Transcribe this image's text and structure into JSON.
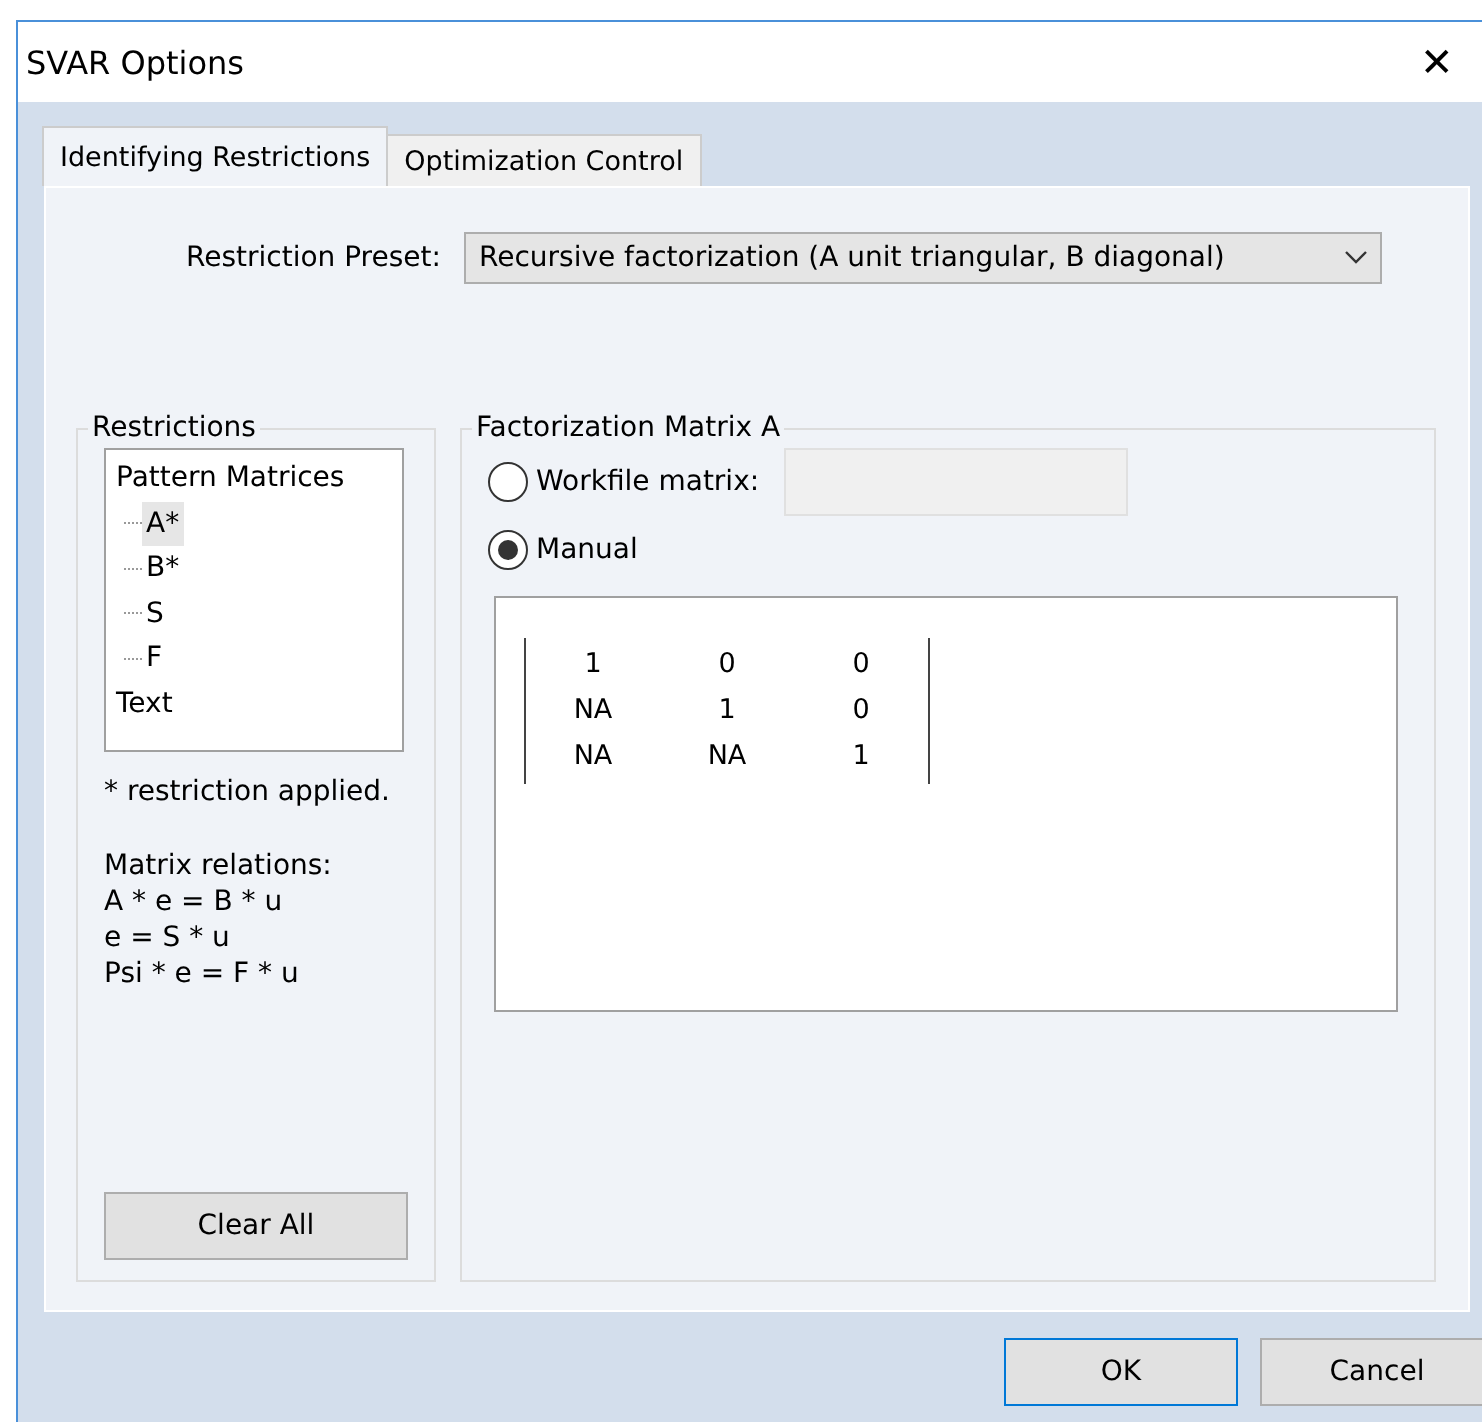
{
  "window": {
    "title": "SVAR Options",
    "close": "✕"
  },
  "tabs": [
    {
      "label": "Identifying Restrictions",
      "selected": true
    },
    {
      "label": "Optimization Control",
      "selected": false
    }
  ],
  "preset": {
    "label": "Restriction Preset:",
    "value": "Recursive factorization (A unit triangular, B diagonal)"
  },
  "restrictions": {
    "title": "Restrictions",
    "tree": [
      {
        "label": "Pattern Matrices",
        "selected": false,
        "children": [
          {
            "label": "A*",
            "selected": true
          },
          {
            "label": "B*",
            "selected": false
          },
          {
            "label": "S",
            "selected": false
          },
          {
            "label": "F",
            "selected": false
          }
        ]
      },
      {
        "label": "Text",
        "selected": false
      }
    ],
    "note": "* restriction applied.",
    "relations": [
      "Matrix relations:",
      "A * e = B * u",
      "e = S * u",
      "Psi * e = F * u"
    ],
    "button": "Clear All"
  },
  "factorization": {
    "title": "Factorization Matrix A",
    "options": [
      {
        "label": "Workfile matrix:",
        "selected": false,
        "kind": "field"
      },
      {
        "label": "Manual",
        "selected": true,
        "kind": "plain"
      }
    ],
    "matrix": [
      [
        "1",
        "0",
        "0"
      ],
      [
        "NA",
        "1",
        "0"
      ],
      [
        "NA",
        "NA",
        "1"
      ]
    ]
  },
  "buttons": [
    {
      "label": "OK",
      "default": true
    },
    {
      "label": "Cancel",
      "default": false
    }
  ]
}
